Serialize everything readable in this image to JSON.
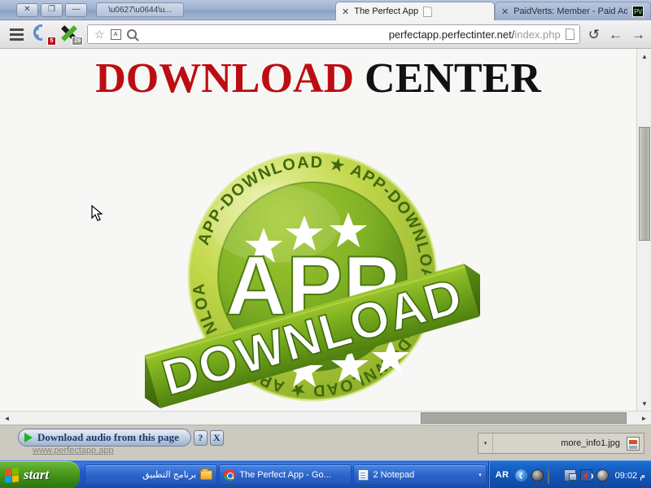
{
  "window": {
    "title": "\\u0627\\u0644\\u...",
    "controls": {
      "close": "✕",
      "restore": "❐",
      "minimize": "—"
    }
  },
  "tabs": [
    {
      "label": "The Perfect App",
      "close": "✕",
      "favicon": "document-icon",
      "active": true
    },
    {
      "label": "PaidVerts: Member - Paid Ad",
      "close": "✕",
      "favicon": "paidverts-icon",
      "favicon_text": "PV",
      "active": false
    }
  ],
  "toolbar": {
    "menu_icon": "hamburger-menu-icon",
    "rss_icon": "rss-reader-icon",
    "rss_badge": "5",
    "x_icon": "ad-blocker-x-icon",
    "x_badge": "29",
    "bookmark_icon": "☆",
    "translate_icon": "translate-icon",
    "translate_text": "A",
    "zoom_icon": "magnifier-icon",
    "url_host": "perfectapp.perfectinter.net/",
    "url_path": "index.php",
    "page_doc_icon": "page-document-icon",
    "reload_icon": "↺",
    "back_icon": "←",
    "forward_icon": "→"
  },
  "page": {
    "heading_first": "DOWNLOAD",
    "heading_second": "CENTER",
    "heading_first_color": "#bb0d12",
    "heading_second_color": "#111111",
    "background": "#f7f7f5",
    "logo": {
      "name": "app-download-badge",
      "center_line1": "APP",
      "ribbon_text": "DOWNLOAD",
      "circular_text": "APP-DOWNLOAD",
      "colors": {
        "light": "#c6d94a",
        "mid": "#8cbf26",
        "dark": "#4f8c13",
        "deep": "#3d6e0c"
      }
    }
  },
  "scrollbars": {
    "v_up": "▲",
    "v_down": "▼",
    "h_left": "◄",
    "h_right": "►"
  },
  "notification": {
    "label": "Download audio from this page",
    "play_icon": "play-triangle-icon",
    "help_label": "?",
    "close_label": "X",
    "ghost_link": "www.perfectapp.app"
  },
  "download": {
    "caret": "▾",
    "filename": "more_info1.jpg",
    "file_icon": "jpg-file-icon"
  },
  "taskbar": {
    "start_label": "start",
    "start_icon": "windows-flag-icon",
    "items": [
      {
        "label": "برنامج التطبيق",
        "icon": "folder-icon",
        "rtl": true
      },
      {
        "label": "The Perfect App - Go...",
        "icon": "chrome-icon",
        "rtl": false
      },
      {
        "label": "2 Notepad",
        "icon": "notepad-icon",
        "rtl": false,
        "group_caret": "▾"
      }
    ],
    "tray": {
      "language": "AR",
      "chevron": "❮",
      "icons": [
        "antivirus-shield-icon",
        "notification-bell-icon",
        "network-connection-icon",
        "volume-speaker-icon",
        "disc-drive-icon"
      ],
      "time": "09:02 م"
    }
  }
}
